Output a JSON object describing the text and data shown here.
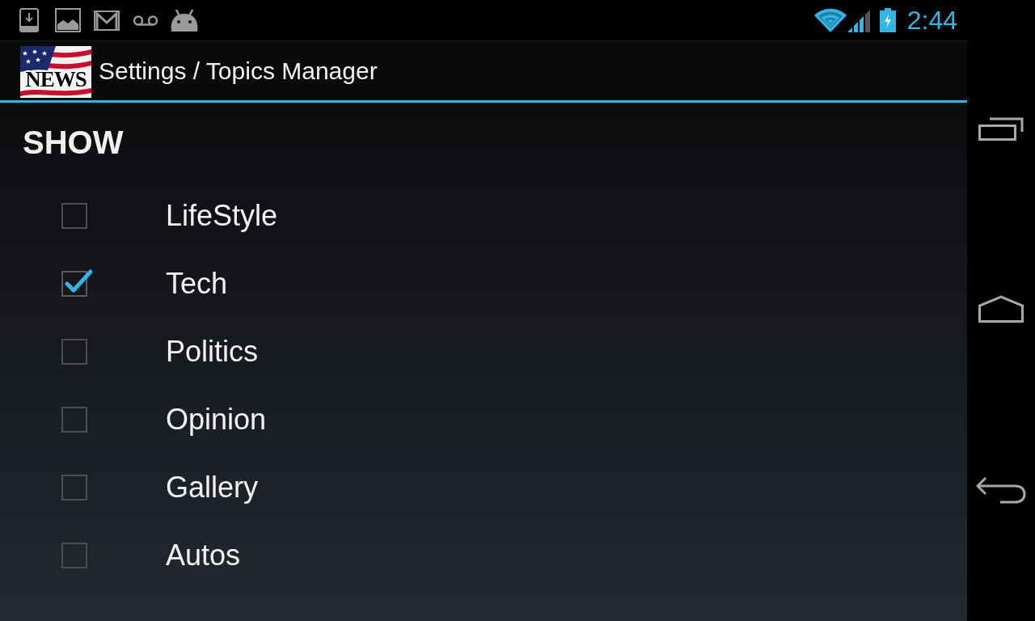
{
  "status_bar": {
    "time": "2:44"
  },
  "action_bar": {
    "logo_text": "NEWS",
    "title": "Settings / Topics Manager"
  },
  "section": {
    "heading": "SHOW",
    "topics": [
      {
        "label": "LifeStyle",
        "checked": false
      },
      {
        "label": "Tech",
        "checked": true
      },
      {
        "label": "Politics",
        "checked": false
      },
      {
        "label": "Opinion",
        "checked": false
      },
      {
        "label": "Gallery",
        "checked": false
      },
      {
        "label": "Autos",
        "checked": false
      }
    ]
  }
}
